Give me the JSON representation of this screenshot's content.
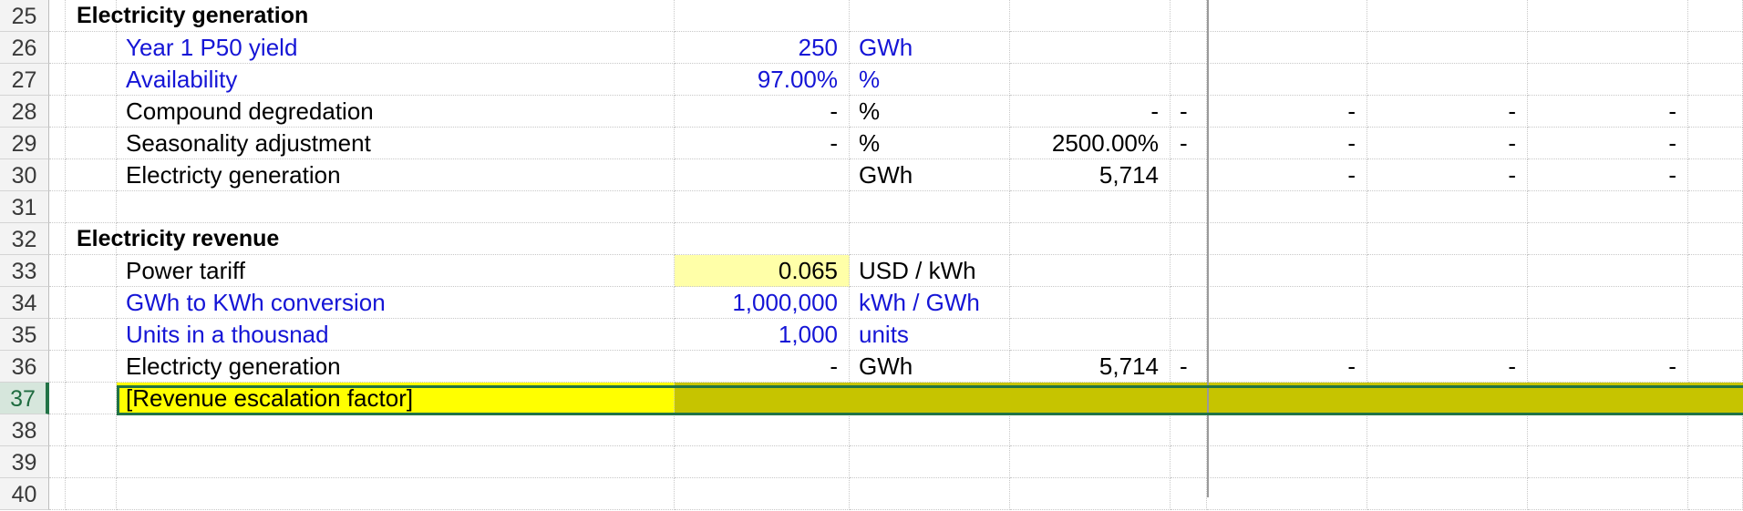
{
  "rows": [
    {
      "num": "25",
      "c1": "Electricity generation",
      "c1_style": "section",
      "val": "",
      "unit": "",
      "c5": "",
      "c6": "",
      "c7": "",
      "c8": "",
      "c9": "",
      "c10": ""
    },
    {
      "num": "26",
      "c2": "Year 1 P50 yield",
      "input": true,
      "val": "250",
      "unit": "GWh",
      "c5": "",
      "c6": "",
      "c7": "",
      "c8": "",
      "c9": "",
      "c10": ""
    },
    {
      "num": "27",
      "c2": "Availability",
      "input": true,
      "val": "97.00%",
      "unit": "%",
      "c5": "",
      "c6": "",
      "c7": "",
      "c8": "",
      "c9": "",
      "c10": ""
    },
    {
      "num": "28",
      "c2": "Compound degredation",
      "val": "-",
      "unit": "%",
      "c5": "-",
      "c6": "-",
      "c7": "-",
      "c8": "-",
      "c9": "-",
      "c10": ""
    },
    {
      "num": "29",
      "c2": "Seasonality adjustment",
      "val": "-",
      "unit": "%",
      "c5": "2500.00%",
      "c6": "-",
      "c7": "-",
      "c8": "-",
      "c9": "-",
      "c10": ""
    },
    {
      "num": "30",
      "c2": "Electricty generation",
      "val": "",
      "unit": "GWh",
      "c5": "5,714",
      "c6": "",
      "c7": "-",
      "c8": "-",
      "c9": "-",
      "c10": ""
    },
    {
      "num": "31",
      "c2": "",
      "val": "",
      "unit": "",
      "c5": "",
      "c6": "",
      "c7": "",
      "c8": "",
      "c9": "",
      "c10": ""
    },
    {
      "num": "32",
      "c1": "Electricity revenue",
      "c1_style": "section",
      "val": "",
      "unit": "",
      "c5": "",
      "c6": "",
      "c7": "",
      "c8": "",
      "c9": "",
      "c10": ""
    },
    {
      "num": "33",
      "c2": "Power tariff",
      "val": "0.065",
      "unit": "USD / kWh",
      "tariff": true,
      "c5": "",
      "c6": "",
      "c7": "",
      "c8": "",
      "c9": "",
      "c10": ""
    },
    {
      "num": "34",
      "c2": "GWh to KWh conversion",
      "input": true,
      "val": "1,000,000",
      "unit": "kWh / GWh",
      "c5": "",
      "c6": "",
      "c7": "",
      "c8": "",
      "c9": "",
      "c10": ""
    },
    {
      "num": "35",
      "c2": "Units in a thousnad",
      "input": true,
      "val": "1,000",
      "unit": "units",
      "c5": "",
      "c6": "",
      "c7": "",
      "c8": "",
      "c9": "",
      "c10": ""
    },
    {
      "num": "36",
      "c2": "Electricty generation",
      "val": "-",
      "unit": "GWh",
      "c5": "5,714",
      "c6": "-",
      "c7": "-",
      "c8": "-",
      "c9": "-",
      "c10": ""
    },
    {
      "num": "37",
      "c2": "[Revenue escalation factor]",
      "selected": true,
      "val": "",
      "unit": "",
      "c5": "",
      "c6": "",
      "c7": "",
      "c8": "",
      "c9": "",
      "c10": ""
    },
    {
      "num": "38",
      "c2": "",
      "val": "",
      "unit": "",
      "c5": "",
      "c6": "",
      "c7": "",
      "c8": "",
      "c9": "",
      "c10": ""
    },
    {
      "num": "39",
      "c2": "",
      "val": "",
      "unit": "",
      "c5": "",
      "c6": "",
      "c7": "",
      "c8": "",
      "c9": "",
      "c10": ""
    },
    {
      "num": "40",
      "c2": "",
      "val": "",
      "unit": "",
      "c5": "",
      "c6": "",
      "c7": "",
      "c8": "",
      "c9": "",
      "c10": ""
    }
  ],
  "colors": {
    "input_text": "#1515d6",
    "tariff_fill": "#ffffa8",
    "highlight_fill": "#ffff00",
    "highlight_dark_fill": "#c6c400",
    "selection_border": "#217346"
  }
}
